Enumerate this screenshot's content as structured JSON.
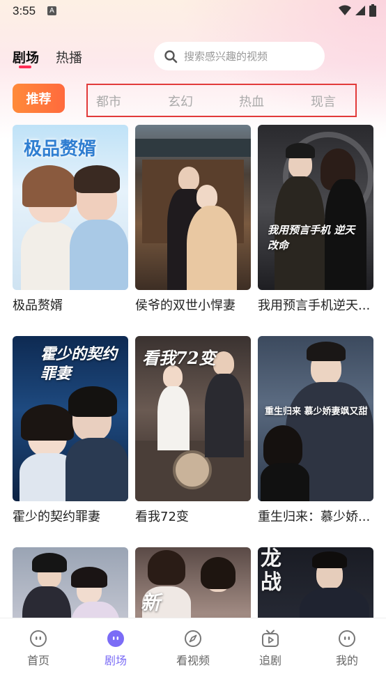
{
  "status_bar": {
    "time": "3:55",
    "notification_letter": "A"
  },
  "header": {
    "tabs": [
      {
        "label": "剧场",
        "active": true
      },
      {
        "label": "热播",
        "active": false
      }
    ],
    "search": {
      "placeholder": "搜索感兴趣的视频"
    }
  },
  "categories": {
    "recommend_label": "推荐",
    "items": [
      "都市",
      "玄幻",
      "热血",
      "现言"
    ]
  },
  "dramas": [
    {
      "title": "极品赘婿",
      "poster_text": "极品赘婿"
    },
    {
      "title": "侯爷的双世小悍妻",
      "poster_text": ""
    },
    {
      "title": "我用预言手机逆天...",
      "poster_text": "我用预言手机 逆天改命"
    },
    {
      "title": "霍少的契约罪妻",
      "poster_text": "霍少的契约罪妻"
    },
    {
      "title": "看我72变",
      "poster_text": "看我72变"
    },
    {
      "title": "重生归来：慕少娇...",
      "poster_text": "重生归来 慕少娇妻飒又甜"
    },
    {
      "title": "",
      "poster_text": ""
    },
    {
      "title": "",
      "poster_text": "新"
    },
    {
      "title": "",
      "poster_text": "龙战"
    }
  ],
  "bottom_nav": [
    {
      "label": "首页",
      "icon": "face-icon",
      "active": false
    },
    {
      "label": "剧场",
      "icon": "face-icon",
      "active": true
    },
    {
      "label": "看视频",
      "icon": "compass-icon",
      "active": false
    },
    {
      "label": "追剧",
      "icon": "tv-play-icon",
      "active": false
    },
    {
      "label": "我的",
      "icon": "face-icon",
      "active": false
    }
  ],
  "colors": {
    "accent": "#ff2d55",
    "recommend_orange": "#ff7a3a",
    "nav_active": "#7b6cf6",
    "highlight_border": "#e23a3a"
  }
}
